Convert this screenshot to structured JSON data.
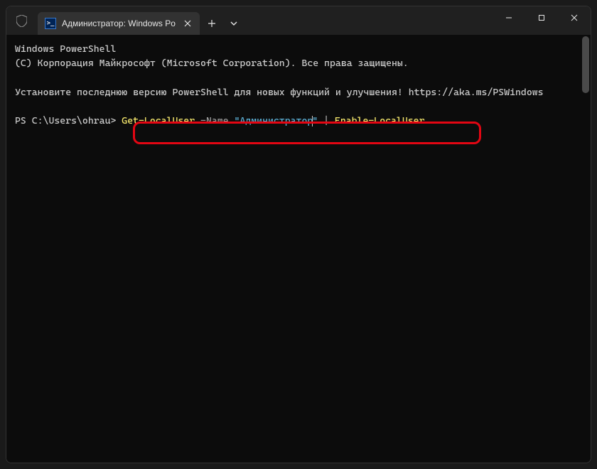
{
  "tab": {
    "title": "Администратор: Windows Po",
    "icon_text": ">_"
  },
  "terminal": {
    "line1": "Windows PowerShell",
    "line2": "(C) Корпорация Майкрософт (Microsoft Corporation). Все права защищены.",
    "line3a": "Установите последнюю версию PowerShell для новых функций и улучшения! ",
    "line3b": "https://aka.ms/PSWindows",
    "prompt": "PS C:\\Users\\ohrau> ",
    "cmd1": "Get-LocalUser",
    "cmd2": " -Name ",
    "cmd3a": "\"Администратор",
    "cmd3b": "\"",
    "cmd4": " | ",
    "cmd5": "Enable-LocalUser"
  }
}
